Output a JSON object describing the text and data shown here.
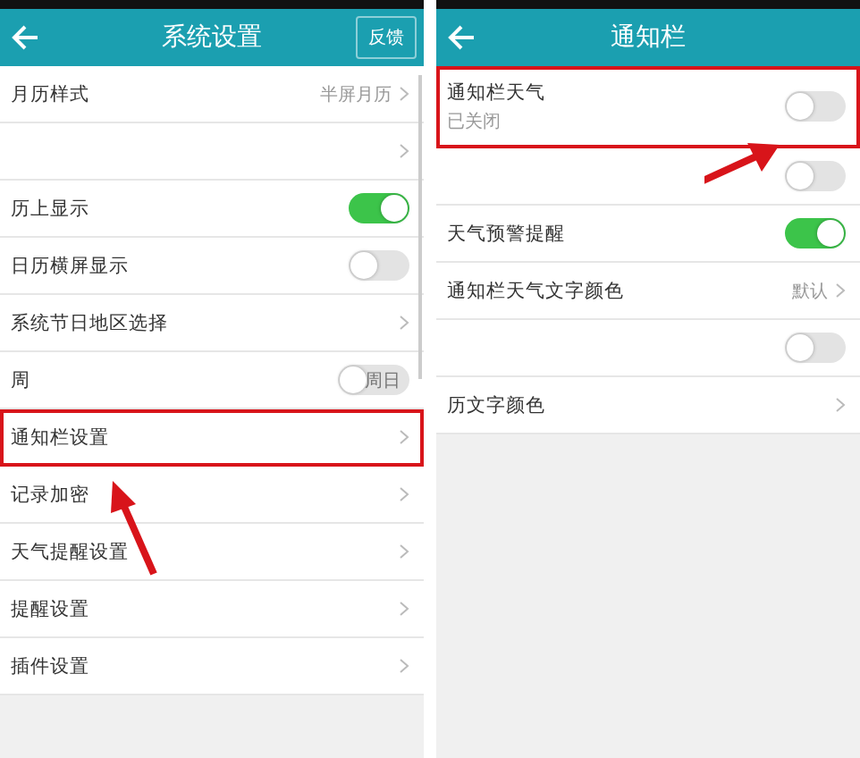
{
  "screens": [
    {
      "title": "系统设置",
      "action_button": "反馈",
      "scrollbar": true,
      "rows": [
        {
          "kind": "value",
          "label": "月历样式",
          "value": "半屏月历",
          "highlighted": false
        },
        {
          "kind": "link",
          "label": "",
          "highlighted": false
        },
        {
          "kind": "toggle",
          "label": "历上显示",
          "on": true,
          "highlighted": false
        },
        {
          "kind": "toggle",
          "label": "日历横屏显示",
          "on": false,
          "highlighted": false
        },
        {
          "kind": "link",
          "label": "系统节日地区选择",
          "highlighted": false
        },
        {
          "kind": "toggle",
          "label": "周",
          "on": false,
          "switch_text": "周日",
          "highlighted": false
        },
        {
          "kind": "link",
          "label": "通知栏设置",
          "highlighted": true
        },
        {
          "kind": "link",
          "label": "记录加密",
          "highlighted": false
        },
        {
          "kind": "link",
          "label": "天气提醒设置",
          "highlighted": false
        },
        {
          "kind": "link",
          "label": "提醒设置",
          "highlighted": false
        },
        {
          "kind": "link",
          "label": "插件设置",
          "highlighted": false
        }
      ]
    },
    {
      "title": "通知栏",
      "scrollbar": false,
      "rows": [
        {
          "kind": "toggle",
          "label": "通知栏天气",
          "sublabel": "已关闭",
          "on": false,
          "highlighted": true
        },
        {
          "kind": "toggle",
          "label": "",
          "on": false,
          "highlighted": false
        },
        {
          "kind": "toggle",
          "label": "天气预警提醒",
          "on": true,
          "highlighted": false
        },
        {
          "kind": "value",
          "label": "通知栏天气文字颜色",
          "value": "默认",
          "highlighted": false
        },
        {
          "kind": "toggle",
          "label": "",
          "on": false,
          "highlighted": false
        },
        {
          "kind": "link",
          "label": "历文字颜色",
          "highlighted": false
        }
      ]
    }
  ]
}
